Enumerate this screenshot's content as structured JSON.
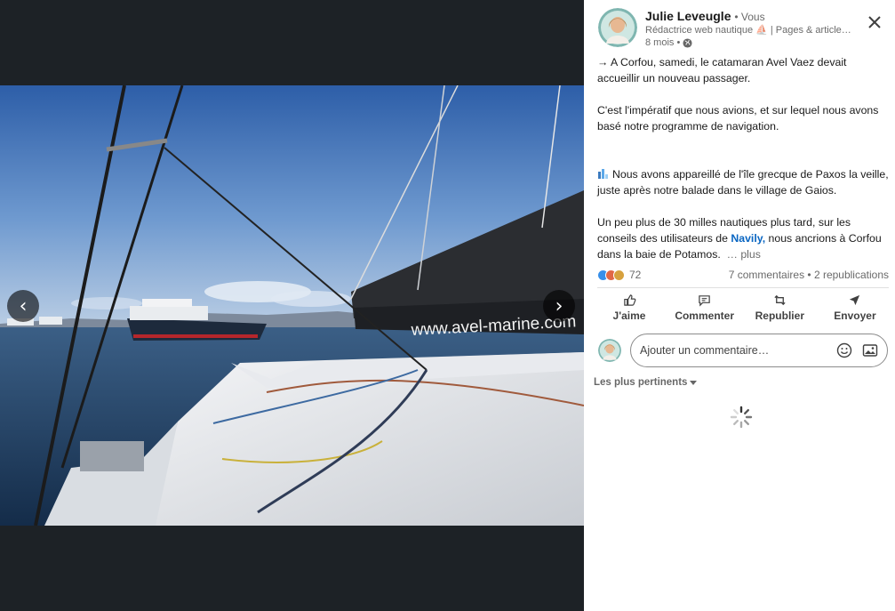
{
  "viewer": {
    "prev_icon": "chevron-left-icon",
    "prev_glyph": "‹",
    "next_icon": "chevron-right-icon",
    "next_glyph": "›",
    "photo_text": "www.avel-marine.com"
  },
  "author": {
    "name": "Julie Leveugle",
    "you_label": "• Vous",
    "headline": "Rédactrice web nautique ⛵ | Pages & articles…",
    "time": "8 mois •"
  },
  "post": {
    "p1": "→ A Corfou, samedi, le catamaran Avel Vaez devait accueillir un nouveau passager.",
    "p2": "C'est l'impératif que nous avions, et sur lequel nous avons basé notre programme de navigation.",
    "p3": "Nous avons appareillé de l'île grecque de Paxos la veille, juste après notre balade dans le village de Gaios.",
    "p4_a": "Un peu plus de 30 milles nautiques plus tard, sur les conseils des utilisateurs de ",
    "p4_link": "Navily,",
    "p4_b": " nous ancrions à Corfou dans la baie de Potamos.",
    "more": "… plus"
  },
  "social": {
    "reaction_count": "72",
    "stats": "7 commentaires • 2 republications"
  },
  "actions": {
    "like": "J'aime",
    "comment": "Commenter",
    "repost": "Republier",
    "send": "Envoyer"
  },
  "comment": {
    "placeholder": "Ajouter un commentaire…"
  },
  "sort": {
    "label": "Les plus pertinents"
  },
  "colors": {
    "link": "#0a66c2",
    "viewer_bg": "#1d2226",
    "like": "#378fe9",
    "celebrate": "#e16745",
    "support": "#d7a13e"
  }
}
